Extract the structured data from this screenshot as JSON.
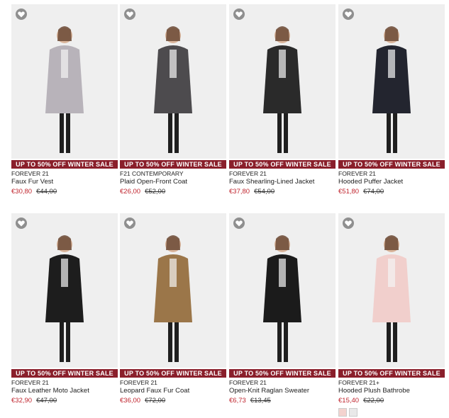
{
  "colors": {
    "banner_bg": "#8a1f2b",
    "sale_price": "#c0262f",
    "favorite_icon_bg": "#8f8f8f"
  },
  "products": [
    {
      "banner": "UP TO 50% OFF WINTER SALE",
      "brand": "FOREVER 21",
      "name": "Faux Fur Vest",
      "sale_price": "€30,80",
      "original_price": "€44,00",
      "photo_bg": "#efefef",
      "garment_color": "#b8b3ba"
    },
    {
      "banner": "UP TO 50% OFF WINTER SALE",
      "brand": "F21 CONTEMPORARY",
      "name": "Plaid Open-Front Coat",
      "sale_price": "€26,00",
      "original_price": "€52,00",
      "photo_bg": "#efefef",
      "garment_color": "#4d4b4e"
    },
    {
      "banner": "UP TO 50% OFF WINTER SALE",
      "brand": "FOREVER 21",
      "name": "Faux Shearling-Lined Jacket",
      "sale_price": "€37,80",
      "original_price": "€54,00",
      "photo_bg": "#efefef",
      "garment_color": "#2a2a2a"
    },
    {
      "banner": "UP TO 50% OFF WINTER SALE",
      "brand": "FOREVER 21",
      "name": "Hooded Puffer Jacket",
      "sale_price": "€51,80",
      "original_price": "€74,00",
      "photo_bg": "#efefef",
      "garment_color": "#23252f"
    },
    {
      "banner": "UP TO 50% OFF WINTER SALE",
      "brand": "FOREVER 21",
      "name": "Faux Leather Moto Jacket",
      "sale_price": "€32,90",
      "original_price": "€47,00",
      "photo_bg": "#efefef",
      "garment_color": "#1d1d1d"
    },
    {
      "banner": "UP TO 50% OFF WINTER SALE",
      "brand": "FOREVER 21",
      "name": "Leopard Faux Fur Coat",
      "sale_price": "€36,00",
      "original_price": "€72,00",
      "photo_bg": "#efefef",
      "garment_color": "#9b7649"
    },
    {
      "banner": "UP TO 50% OFF WINTER SALE",
      "brand": "FOREVER 21",
      "name": "Open-Knit Raglan Sweater",
      "sale_price": "€6,73",
      "original_price": "€13,45",
      "photo_bg": "#efefef",
      "garment_color": "#1b1b1b"
    },
    {
      "banner": "UP TO 50% OFF WINTER SALE",
      "brand": "FOREVER 21+",
      "name": "Hooded Plush Bathrobe",
      "sale_price": "€15,40",
      "original_price": "€22,00",
      "photo_bg": "#efefef",
      "garment_color": "#f1cfcc",
      "swatches": [
        "#f3d3cf",
        "#e9e9e9"
      ]
    }
  ]
}
